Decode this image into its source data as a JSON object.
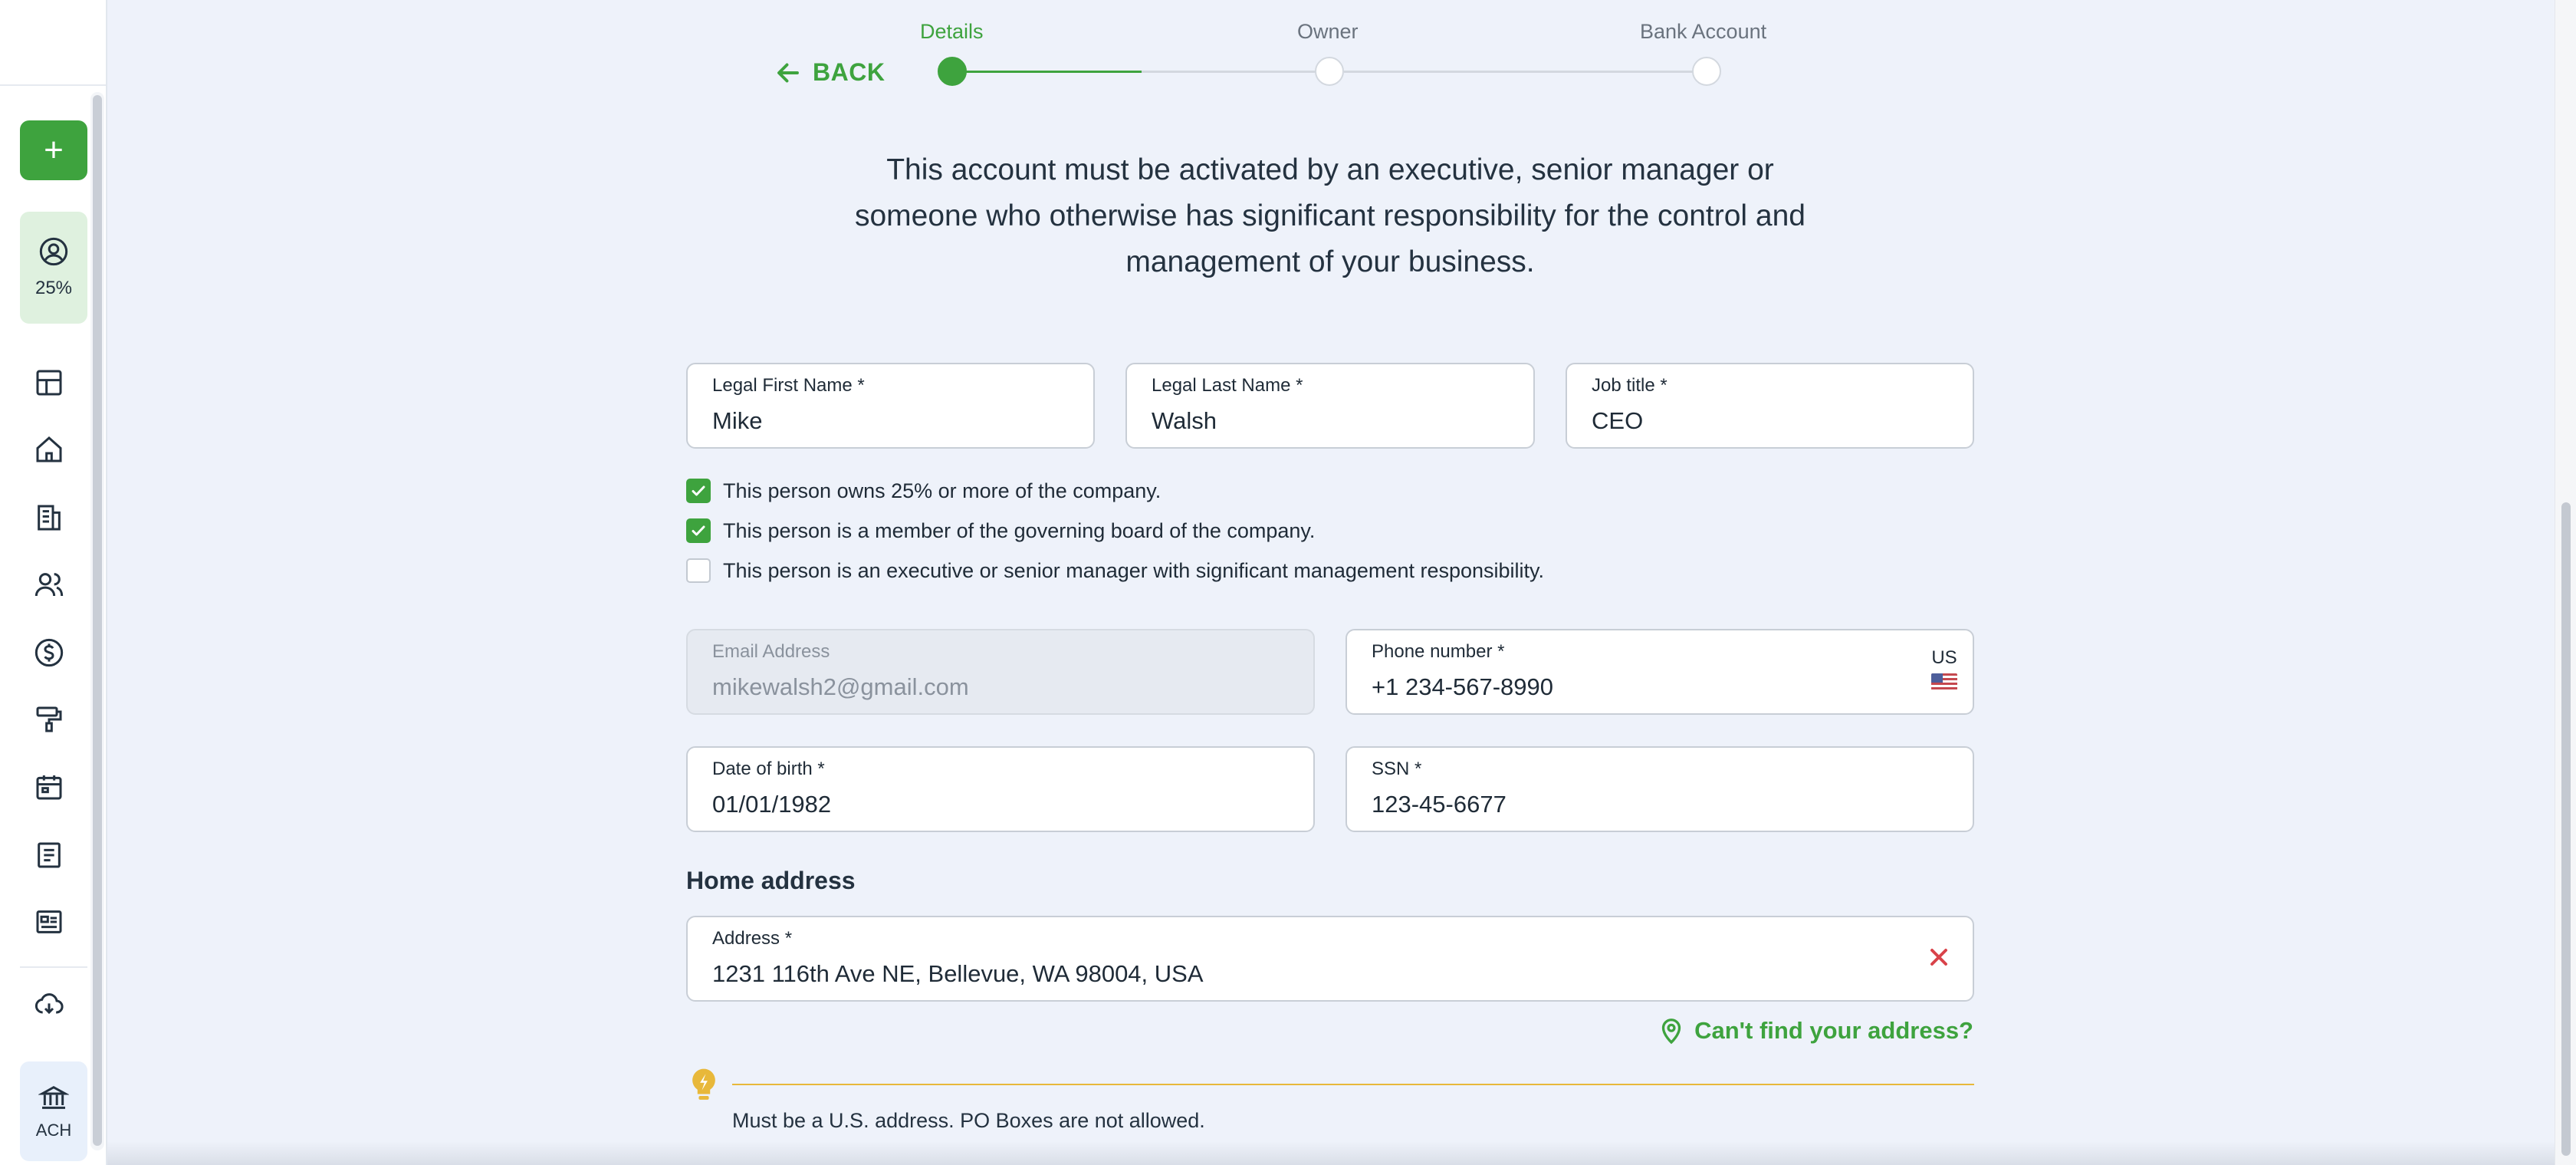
{
  "sidebar": {
    "add_label": "+",
    "progress": {
      "percent_label": "25%",
      "icon": "user-circle-icon"
    },
    "nav_icons": [
      "dashboard-icon",
      "home-icon",
      "invoices-icon",
      "customers-icon",
      "payments-icon",
      "paint-roller-icon",
      "calendar-icon",
      "notes-icon",
      "card-icon",
      "download-icon"
    ],
    "ach": {
      "label": "ACH",
      "icon": "bank-icon"
    }
  },
  "stepper": {
    "back_label": "BACK",
    "steps": [
      {
        "label": "Details",
        "state": "active"
      },
      {
        "label": "Owner",
        "state": "pending"
      },
      {
        "label": "Bank Account",
        "state": "pending"
      }
    ]
  },
  "intro": "This account must be activated by an executive, senior manager or someone who otherwise has significant responsibility for the control and management of your business.",
  "form": {
    "first_name": {
      "label": "Legal First Name *",
      "value": "Mike"
    },
    "last_name": {
      "label": "Legal Last Name *",
      "value": "Walsh"
    },
    "job_title": {
      "label": "Job title *",
      "value": "CEO"
    },
    "checks": [
      {
        "label": "This person owns 25% or more of the company.",
        "checked": true
      },
      {
        "label": "This person is a member of the governing board of the company.",
        "checked": true
      },
      {
        "label": "This person is an executive or senior manager with significant management responsibility.",
        "checked": false
      }
    ],
    "email": {
      "label": "Email Address",
      "value": "mikewalsh2@gmail.com"
    },
    "phone": {
      "label": "Phone number *",
      "value": "+1 234-567-8990",
      "country": "US"
    },
    "dob": {
      "label": "Date of birth *",
      "value": "01/01/1982"
    },
    "ssn": {
      "label": "SSN *",
      "value": "123-45-6677"
    },
    "home_address_title": "Home address",
    "address": {
      "label": "Address *",
      "value": "1231 116th Ave NE, Bellevue, WA 98004, USA"
    },
    "cant_find": "Can't find your address?",
    "tip": "Must be a U.S. address. PO Boxes are not allowed."
  },
  "colors": {
    "accent": "#3ea33e",
    "tip": "#e8b83a",
    "error": "#d9434a"
  }
}
